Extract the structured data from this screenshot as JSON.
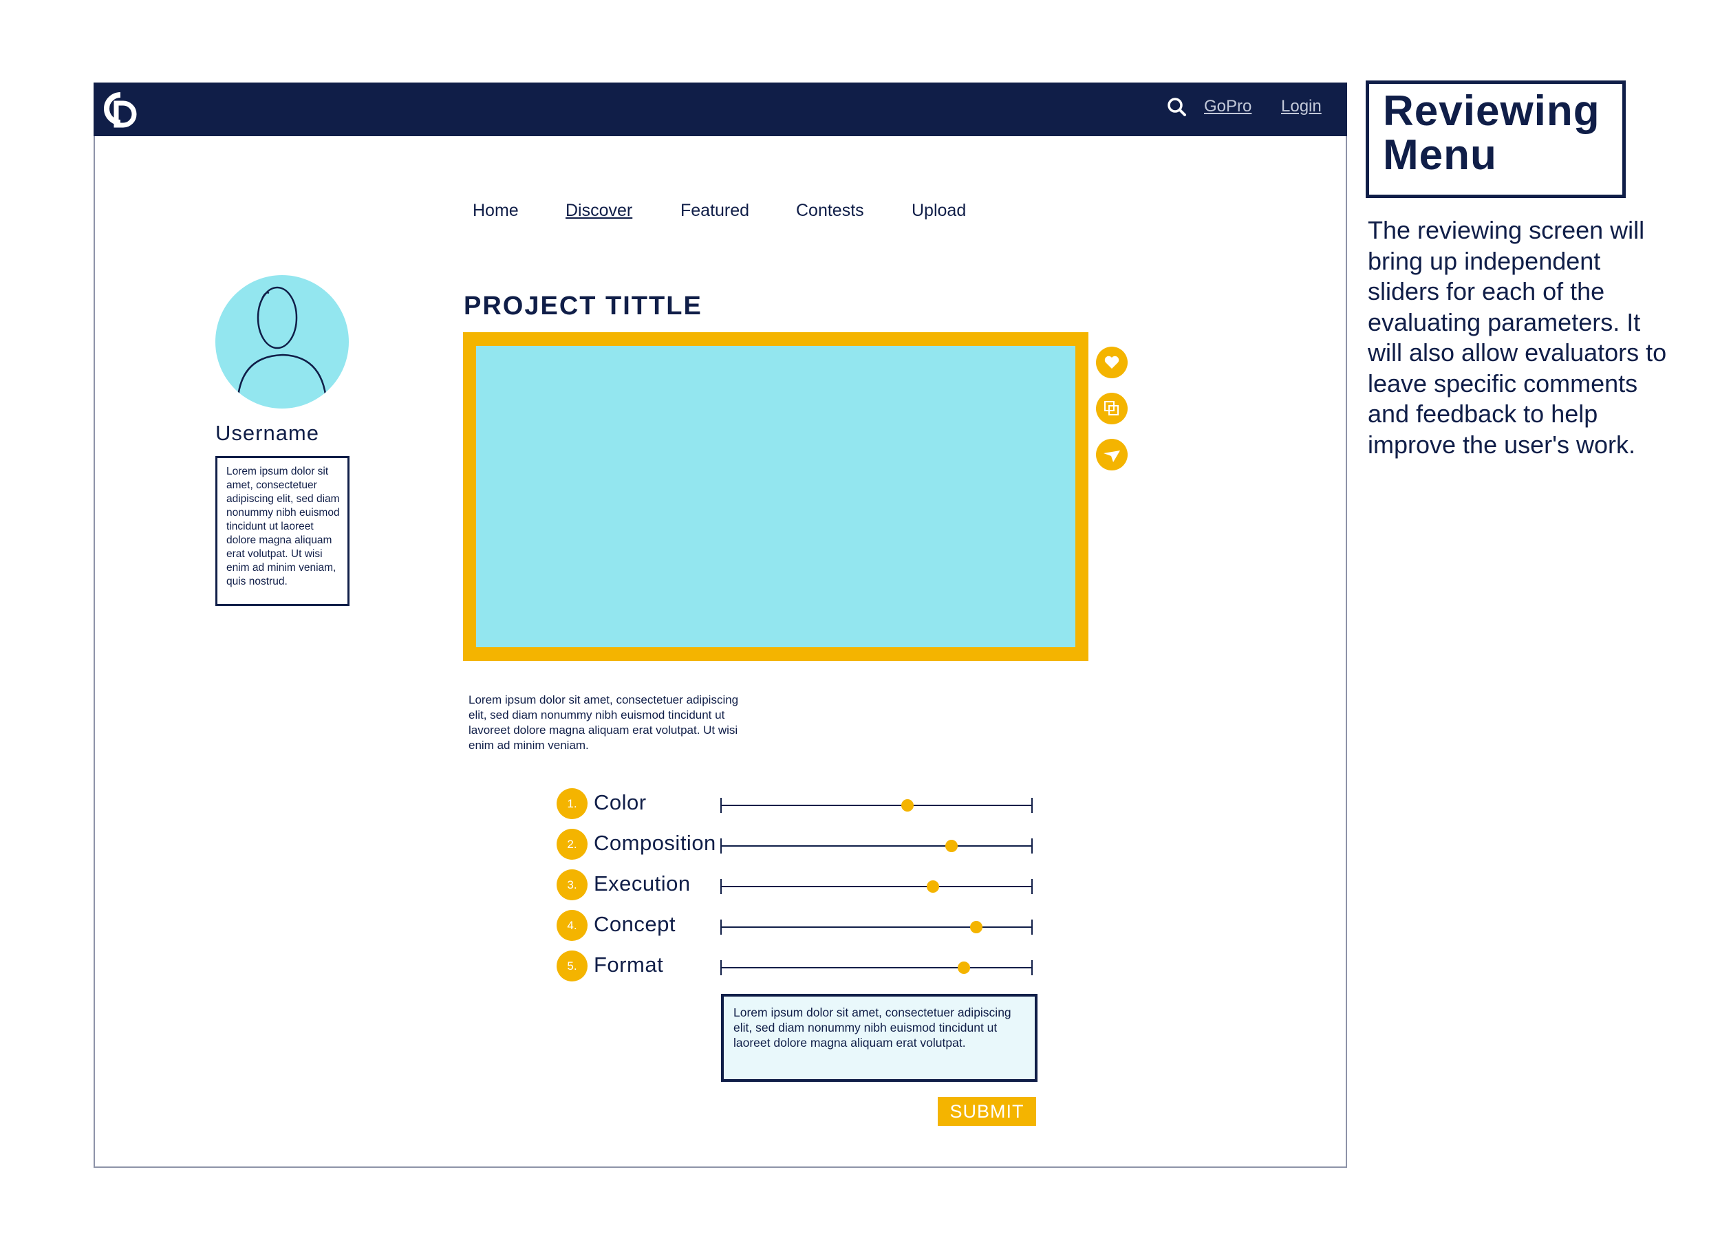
{
  "header": {
    "logo_icon": "cd-logo-icon",
    "search_icon": "search-icon",
    "links": {
      "gopro": "GoPro",
      "login": "Login"
    }
  },
  "nav": {
    "items": [
      {
        "label": "Home",
        "active": false
      },
      {
        "label": "Discover",
        "active": true
      },
      {
        "label": "Featured",
        "active": false
      },
      {
        "label": "Contests",
        "active": false
      },
      {
        "label": "Upload",
        "active": false
      }
    ]
  },
  "profile": {
    "avatar_icon": "user-avatar-icon",
    "username": "Username",
    "bio": "Lorem ipsum dolor sit amet, consectetuer adipiscing elit, sed diam nonummy nibh euismod tincidunt ut laoreet dolore magna aliquam erat volutpat. Ut wisi enim ad minim veniam, quis nostrud."
  },
  "project": {
    "title": "PROJECT TITTLE",
    "actions": [
      "heart-icon",
      "copy-icon",
      "send-icon"
    ],
    "description": "Lorem ipsum dolor sit amet, consectetuer adipiscing elit, sed diam nonummy nibh euismod tincidunt ut lavoreet dolore magna aliquam erat volutpat. Ut wisi enim ad minim veniam."
  },
  "review": {
    "parameters": [
      {
        "number": "1.",
        "label": "Color",
        "value": 0.6
      },
      {
        "number": "2.",
        "label": "Composition",
        "value": 0.74
      },
      {
        "number": "3.",
        "label": "Execution",
        "value": 0.68
      },
      {
        "number": "4.",
        "label": "Concept",
        "value": 0.82
      },
      {
        "number": "5.",
        "label": "Format",
        "value": 0.78
      }
    ],
    "comment": "Lorem ipsum dolor sit amet, consectetuer adipiscing elit, sed diam nonummy nibh euismod tincidunt ut laoreet dolore magna aliquam erat volutpat.",
    "submit_label": "SUBMIT"
  },
  "annotation": {
    "title_line1": "Reviewing",
    "title_line2": "Menu",
    "body": "The reviewing screen will bring up independent sliders for each of the evaluating parameters. It will also allow evaluators to leave specific comments and feedback to help improve the user's work."
  },
  "colors": {
    "navy": "#101e48",
    "accent_yellow": "#f4b400",
    "light_cyan": "#93e6ef",
    "comment_bg": "#e9f8fb"
  }
}
